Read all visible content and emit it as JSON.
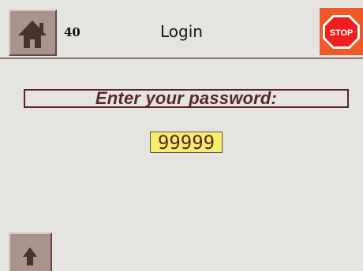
{
  "header": {
    "screen_number": "40",
    "title": "Login",
    "home_icon": "home-icon",
    "stop_label": "STOP",
    "stop_icon": "stop-sign-icon"
  },
  "colors": {
    "background": "#e6e4e1",
    "header_line": "#8c6f66",
    "button_fill": "#a9948d",
    "stop_fill": "#f05a28",
    "prompt_text": "#5b2727",
    "password_fill": "#f4ee6e"
  },
  "main": {
    "prompt": "Enter your password:",
    "password_value": "99999"
  },
  "footer": {
    "up_icon": "up-arrow-icon"
  }
}
